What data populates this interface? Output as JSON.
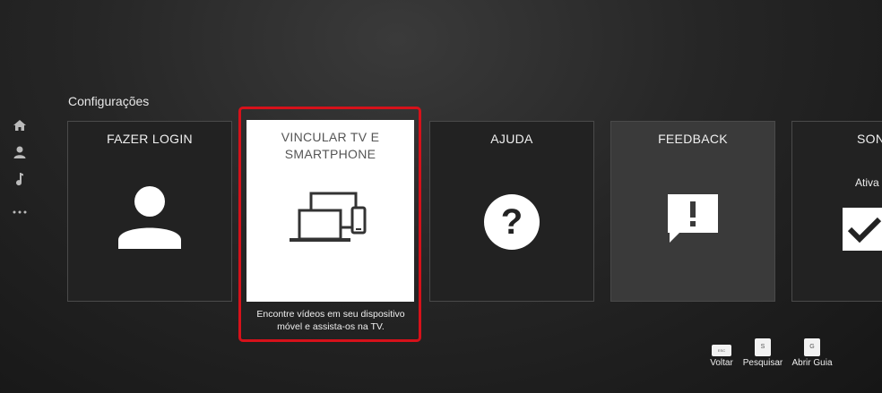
{
  "section_title": "Configurações",
  "sidebar": {
    "items": [
      {
        "icon": "home-icon"
      },
      {
        "icon": "user-icon"
      },
      {
        "icon": "music-note-icon"
      },
      {
        "icon": "more-icon"
      }
    ]
  },
  "cards": [
    {
      "label": "FAZER LOGIN",
      "icon": "user-silhouette-icon"
    },
    {
      "label_line1": "VINCULAR TV E",
      "label_line2": "SMARTPHONE",
      "icon": "devices-icon",
      "selected": true
    },
    {
      "label": "AJUDA",
      "icon": "help-icon"
    },
    {
      "label": "FEEDBACK",
      "icon": "feedback-icon"
    },
    {
      "label": "SON",
      "sublabel": "Ativa",
      "icon": "checkbox-checked-icon"
    }
  ],
  "selected_description": {
    "line1": "Encontre vídeos em seu dispositivo",
    "line2": "móvel e assista-os na TV."
  },
  "hints": {
    "back": {
      "key": "ESC",
      "label": "Voltar"
    },
    "search": {
      "key": "S",
      "label": "Pesquisar"
    },
    "guide": {
      "key": "G",
      "label": "Abrir Guia"
    }
  },
  "colors": {
    "highlight": "#d6111a",
    "background": "#262626"
  }
}
